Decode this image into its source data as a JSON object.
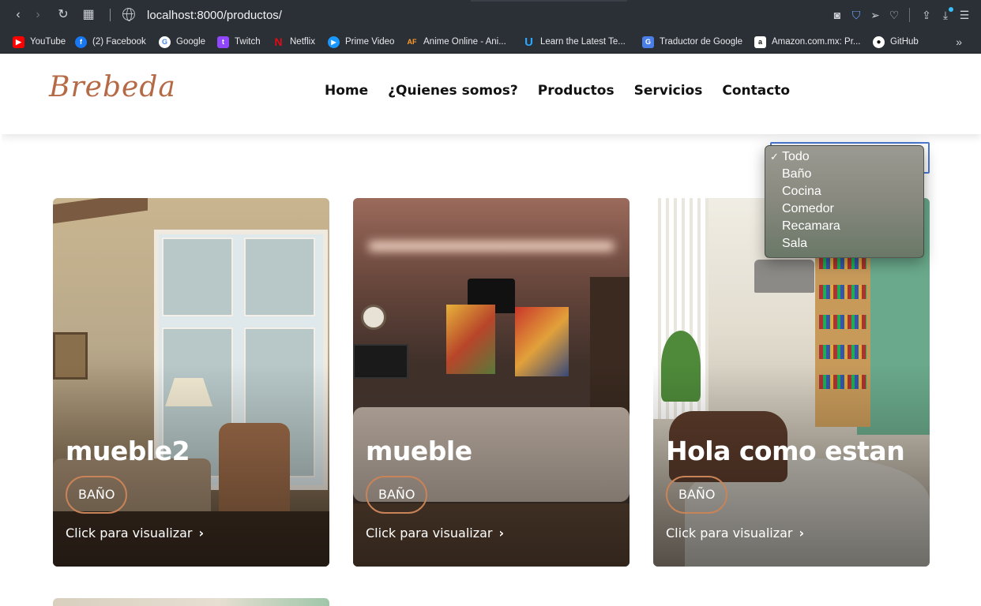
{
  "browser": {
    "url": "localhost:8000/productos/",
    "bookmarks": [
      {
        "label": "YouTube",
        "color": "#ff0000",
        "glyph": "▶"
      },
      {
        "label": "(2) Facebook",
        "color": "#1877f2",
        "glyph": "f"
      },
      {
        "label": "Google",
        "color": "#ffffff",
        "glyph": "G"
      },
      {
        "label": "Twitch",
        "color": "#9146ff",
        "glyph": "t"
      },
      {
        "label": "Netflix",
        "color": "#2b2f36",
        "glyph": "N"
      },
      {
        "label": "Prime Video",
        "color": "#1a98ff",
        "glyph": "▶"
      },
      {
        "label": "Anime Online - Ani...",
        "color": "#2b2f36",
        "glyph": "AF"
      },
      {
        "label": "Learn the Latest Te...",
        "color": "#2b2f36",
        "glyph": "U"
      },
      {
        "label": "Traductor de Google",
        "color": "#4a7ee8",
        "glyph": "G"
      },
      {
        "label": "Amazon.com.mx: Pr...",
        "color": "#ffffff",
        "glyph": "a"
      },
      {
        "label": "GitHub",
        "color": "#2b2f36",
        "glyph": "●"
      }
    ]
  },
  "site": {
    "logo": "Brebeda",
    "nav": [
      "Home",
      "¿Quienes somos?",
      "Productos",
      "Servicios",
      "Contacto"
    ]
  },
  "filter": {
    "options": [
      "Todo",
      "Baño",
      "Cocina",
      "Comedor",
      "Recamara",
      "Sala"
    ],
    "selected": "Todo",
    "check": "✓"
  },
  "products": [
    {
      "title": "mueble2",
      "category": "BAÑO",
      "link": "Click para visualizar"
    },
    {
      "title": "mueble",
      "category": "BAÑO",
      "link": "Click para visualizar"
    },
    {
      "title": "Hola como estan",
      "category": "BAÑO",
      "link": "Click para visualizar"
    }
  ],
  "icons": {
    "back": "‹",
    "forward": "›",
    "reload": "↻",
    "grid": "▦",
    "chevron": "›",
    "more": "»"
  }
}
